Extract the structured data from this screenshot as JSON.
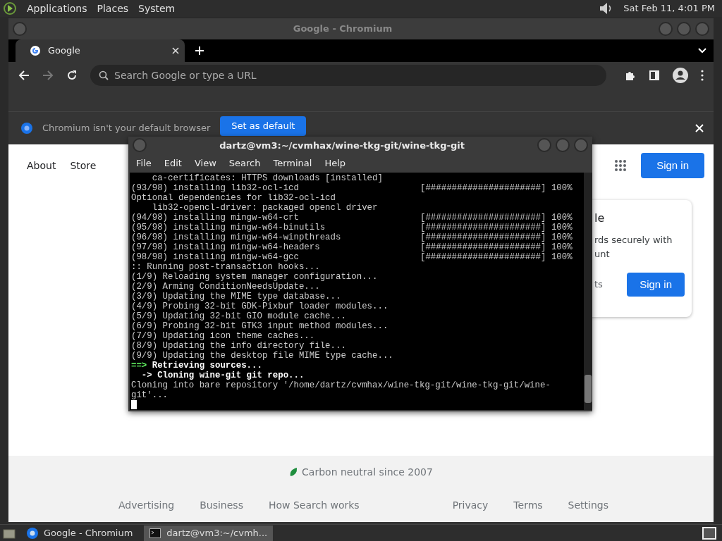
{
  "top_panel": {
    "menus": [
      "Applications",
      "Places",
      "System"
    ],
    "clock": "Sat Feb 11,  4:01 PM"
  },
  "browser": {
    "title": "Google - Chromium",
    "tabs": [
      {
        "label": "Google",
        "selected": true
      }
    ],
    "omnibox": {
      "placeholder": "Search Google or type a URL"
    },
    "forward_disabled": true,
    "infobar": {
      "message": "Chromium isn't your default browser",
      "button": "Set as default"
    },
    "page": {
      "nav_left": [
        "About",
        "Store"
      ],
      "sign_in": "Sign in",
      "card": {
        "heading": "le",
        "lines": [
          "rds securely with",
          "unt"
        ],
        "link": "ts",
        "button": "Sign in"
      },
      "carbon": "Carbon neutral since 2007",
      "footer_left": [
        "Advertising",
        "Business",
        "How Search works"
      ],
      "footer_right": [
        "Privacy",
        "Terms",
        "Settings"
      ]
    }
  },
  "terminal": {
    "title": "dartz@vm3:~/cvmhax/wine-tkg-git/wine-tkg-git",
    "menus": [
      "File",
      "Edit",
      "View",
      "Search",
      "Terminal",
      "Help"
    ],
    "lines": [
      {
        "kind": "plain",
        "text": "    ca-certificates: HTTPS downloads [installed]"
      },
      {
        "kind": "progress",
        "text": "(93/98) installing lib32-ocl-icd",
        "bar": "[######################]",
        "percent": "100%"
      },
      {
        "kind": "plain",
        "text": "Optional dependencies for lib32-ocl-icd"
      },
      {
        "kind": "plain",
        "text": "    lib32-opencl-driver: packaged opencl driver"
      },
      {
        "kind": "progress",
        "text": "(94/98) installing mingw-w64-crt",
        "bar": "[######################]",
        "percent": "100%"
      },
      {
        "kind": "progress",
        "text": "(95/98) installing mingw-w64-binutils",
        "bar": "[######################]",
        "percent": "100%"
      },
      {
        "kind": "progress",
        "text": "(96/98) installing mingw-w64-winpthreads",
        "bar": "[######################]",
        "percent": "100%"
      },
      {
        "kind": "progress",
        "text": "(97/98) installing mingw-w64-headers",
        "bar": "[######################]",
        "percent": "100%"
      },
      {
        "kind": "progress",
        "text": "(98/98) installing mingw-w64-gcc",
        "bar": "[######################]",
        "percent": "100%"
      },
      {
        "kind": "plain",
        "text": ":: Running post-transaction hooks..."
      },
      {
        "kind": "plain",
        "text": "(1/9) Reloading system manager configuration..."
      },
      {
        "kind": "plain",
        "text": "(2/9) Arming ConditionNeedsUpdate..."
      },
      {
        "kind": "plain",
        "text": "(3/9) Updating the MIME type database..."
      },
      {
        "kind": "plain",
        "text": "(4/9) Probing 32-bit GDK-Pixbuf loader modules..."
      },
      {
        "kind": "plain",
        "text": "(5/9) Updating 32-bit GIO module cache..."
      },
      {
        "kind": "plain",
        "text": "(6/9) Probing 32-bit GTK3 input method modules..."
      },
      {
        "kind": "plain",
        "text": "(7/9) Updating icon theme caches..."
      },
      {
        "kind": "plain",
        "text": "(8/9) Updating the info directory file..."
      },
      {
        "kind": "plain",
        "text": "(9/9) Updating the desktop file MIME type cache..."
      },
      {
        "kind": "step",
        "marker": "==>",
        "text": "Retrieving sources..."
      },
      {
        "kind": "substep",
        "marker": "  ->",
        "text": "Cloning wine-git git repo..."
      },
      {
        "kind": "plain",
        "text": "Cloning into bare repository '/home/dartz/cvmhax/wine-tkg-git/wine-tkg-git/wine-"
      },
      {
        "kind": "plain",
        "text": "git'..."
      }
    ]
  },
  "taskbar": {
    "tasks": [
      {
        "label": "Google - Chromium",
        "kind": "browser",
        "selected": false
      },
      {
        "label": "dartz@vm3:~/cvmh...",
        "kind": "terminal",
        "selected": true
      }
    ]
  }
}
